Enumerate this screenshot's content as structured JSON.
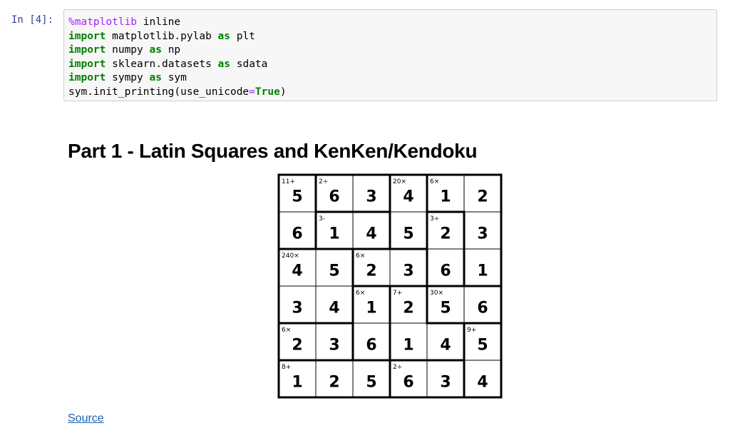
{
  "cell": {
    "prompt": "In [4]:",
    "lines": [
      [
        {
          "t": "%matplotlib",
          "c": "mg"
        },
        {
          "t": " inline",
          "c": ""
        }
      ],
      [
        {
          "t": "import",
          "c": "kw"
        },
        {
          "t": " matplotlib.pylab ",
          "c": ""
        },
        {
          "t": "as",
          "c": "kw"
        },
        {
          "t": " plt",
          "c": ""
        }
      ],
      [
        {
          "t": "import",
          "c": "kw"
        },
        {
          "t": " numpy ",
          "c": ""
        },
        {
          "t": "as",
          "c": "kw"
        },
        {
          "t": " np",
          "c": ""
        }
      ],
      [
        {
          "t": "import",
          "c": "kw"
        },
        {
          "t": " sklearn.datasets ",
          "c": ""
        },
        {
          "t": "as",
          "c": "kw"
        },
        {
          "t": " sdata",
          "c": ""
        }
      ],
      [
        {
          "t": "import",
          "c": "kw"
        },
        {
          "t": " sympy ",
          "c": ""
        },
        {
          "t": "as",
          "c": "kw"
        },
        {
          "t": " sym",
          "c": ""
        }
      ],
      [
        {
          "t": "sym.init_printing(use_unicode",
          "c": ""
        },
        {
          "t": "=",
          "c": "op"
        },
        {
          "t": "True",
          "c": "kw"
        },
        {
          "t": ")",
          "c": ""
        }
      ]
    ]
  },
  "title": "Part 1 - Latin Squares and KenKen/Kendoku",
  "kenken": {
    "grid": [
      [
        5,
        6,
        3,
        4,
        1,
        2
      ],
      [
        6,
        1,
        4,
        5,
        2,
        3
      ],
      [
        4,
        5,
        2,
        3,
        6,
        1
      ],
      [
        3,
        4,
        1,
        2,
        5,
        6
      ],
      [
        2,
        3,
        6,
        1,
        4,
        5
      ],
      [
        1,
        2,
        5,
        6,
        3,
        4
      ]
    ],
    "cages": [
      {
        "clue": "11+",
        "cells": [
          [
            0,
            0
          ],
          [
            1,
            0
          ]
        ]
      },
      {
        "clue": "2÷",
        "cells": [
          [
            0,
            1
          ],
          [
            0,
            2
          ]
        ]
      },
      {
        "clue": "20×",
        "cells": [
          [
            0,
            3
          ],
          [
            1,
            3
          ]
        ]
      },
      {
        "clue": "6×",
        "cells": [
          [
            0,
            4
          ],
          [
            0,
            5
          ],
          [
            1,
            5
          ],
          [
            2,
            5
          ]
        ]
      },
      {
        "clue": "3-",
        "cells": [
          [
            1,
            1
          ],
          [
            1,
            2
          ]
        ]
      },
      {
        "clue": "3÷",
        "cells": [
          [
            1,
            4
          ],
          [
            2,
            4
          ]
        ]
      },
      {
        "clue": "240×",
        "cells": [
          [
            2,
            0
          ],
          [
            2,
            1
          ],
          [
            3,
            0
          ],
          [
            3,
            1
          ]
        ]
      },
      {
        "clue": "6×",
        "cells": [
          [
            2,
            2
          ],
          [
            2,
            3
          ]
        ]
      },
      {
        "clue": "6×",
        "cells": [
          [
            3,
            2
          ],
          [
            4,
            2
          ]
        ]
      },
      {
        "clue": "7+",
        "cells": [
          [
            3,
            3
          ],
          [
            4,
            3
          ],
          [
            4,
            4
          ]
        ]
      },
      {
        "clue": "30×",
        "cells": [
          [
            3,
            4
          ],
          [
            3,
            5
          ]
        ]
      },
      {
        "clue": "6×",
        "cells": [
          [
            4,
            0
          ],
          [
            4,
            1
          ]
        ]
      },
      {
        "clue": "9+",
        "cells": [
          [
            4,
            5
          ],
          [
            5,
            5
          ]
        ]
      },
      {
        "clue": "8+",
        "cells": [
          [
            5,
            0
          ],
          [
            5,
            1
          ],
          [
            5,
            2
          ]
        ]
      },
      {
        "clue": "2÷",
        "cells": [
          [
            5,
            3
          ],
          [
            5,
            4
          ]
        ]
      }
    ]
  },
  "source_link": "Source"
}
